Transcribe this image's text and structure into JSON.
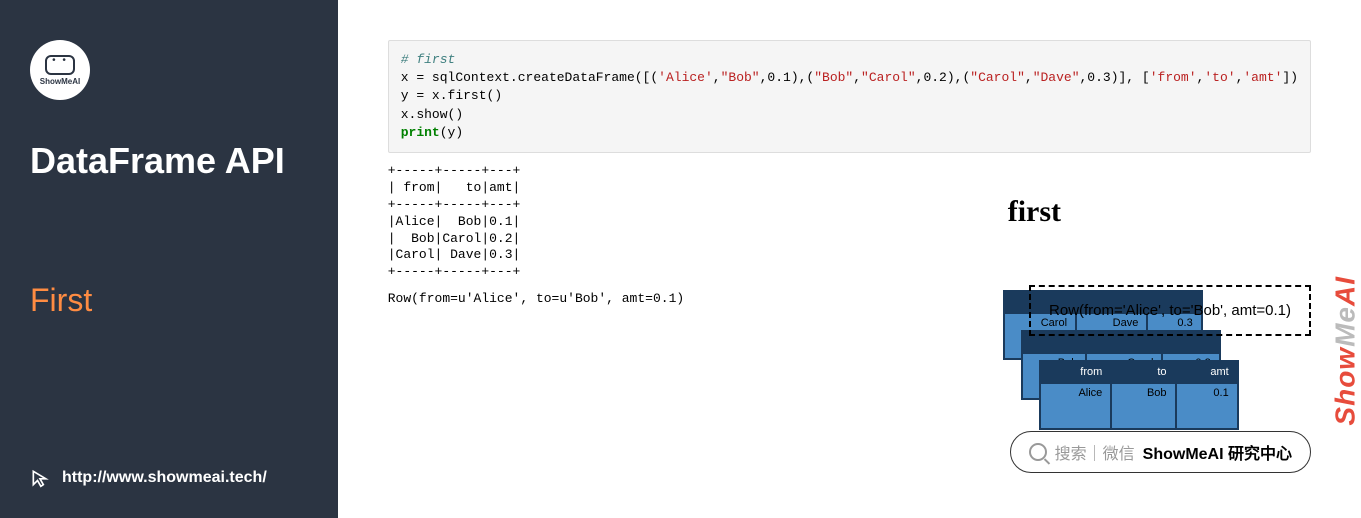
{
  "sidebar": {
    "logo_text": "ShowMeAI",
    "title": "DataFrame API",
    "subtitle": "First",
    "url": "http://www.showmeai.tech/"
  },
  "code": {
    "comment": "# first",
    "line2a": "x = sqlContext.createDataFrame([(",
    "s1": "'Alice'",
    "line2b": ",",
    "s2": "\"Bob\"",
    "line2c": ",0.1),(",
    "s3": "\"Bob\"",
    "line2d": ",",
    "s4": "\"Carol\"",
    "line2e": ",0.2),(",
    "s5": "\"Carol\"",
    "line2f": ",",
    "s6": "\"Dave\"",
    "line2g": ",0.3)], [",
    "s7": "'from'",
    "line2h": ",",
    "s8": "'to'",
    "line2i": ",",
    "s9": "'amt'",
    "line2j": "])",
    "line3": "y = x.first()",
    "line4": "x.show()",
    "kw_print": "print",
    "line5b": "(y)"
  },
  "table_output": "+-----+-----+---+\n| from|   to|amt|\n+-----+-----+---+\n|Alice|  Bob|0.1|\n|  Bob|Carol|0.2|\n|Carol| Dave|0.3|\n+-----+-----+---+",
  "row_output": "Row(from=u'Alice', to=u'Bob', amt=0.1)",
  "heading": "first",
  "mini_tables": {
    "t1": {
      "h1": "from",
      "h2": "to",
      "h3": "amt",
      "r1": "Alice",
      "r2": "Bob",
      "r3": "0.1"
    },
    "t2": {
      "r1": "Bob",
      "r2": "Carol",
      "r3": "0.2"
    },
    "t3": {
      "r1": "Carol",
      "r2": "Dave",
      "r3": "0.3"
    }
  },
  "result_box": "Row(from='Alice', to='Bob', amt=0.1)",
  "search": {
    "gray": "搜索｜微信",
    "bold": "ShowMeAI 研究中心"
  },
  "watermark": {
    "a": "Show",
    "b": "Me",
    "c": "AI"
  },
  "chart_data": {
    "type": "table",
    "columns": [
      "from",
      "to",
      "amt"
    ],
    "rows": [
      [
        "Alice",
        "Bob",
        0.1
      ],
      [
        "Bob",
        "Carol",
        0.2
      ],
      [
        "Carol",
        "Dave",
        0.3
      ]
    ],
    "first_row": {
      "from": "Alice",
      "to": "Bob",
      "amt": 0.1
    }
  }
}
